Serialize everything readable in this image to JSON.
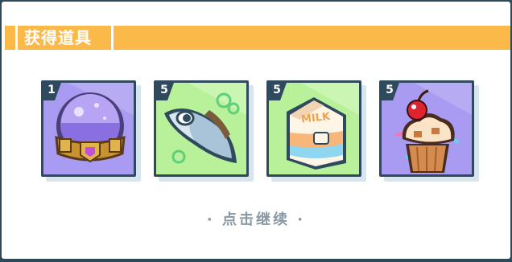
{
  "dialog": {
    "title": "获得道具",
    "continue_label": "· 点击继续 ·"
  },
  "items": [
    {
      "name": "purple-dome-helmet",
      "quantity": "1",
      "background": "#a99bf1"
    },
    {
      "name": "fish",
      "quantity": "5",
      "background": "#b9f19a"
    },
    {
      "name": "milk-carton",
      "quantity": "5",
      "background": "#b9f19a"
    },
    {
      "name": "cherry-cupcake",
      "quantity": "5",
      "background": "#a99bf1"
    }
  ],
  "colors": {
    "accent": "#fbb94a",
    "frame": "#2f4a5c",
    "continue_text": "#8a98a4"
  },
  "milk_label": "MILK"
}
